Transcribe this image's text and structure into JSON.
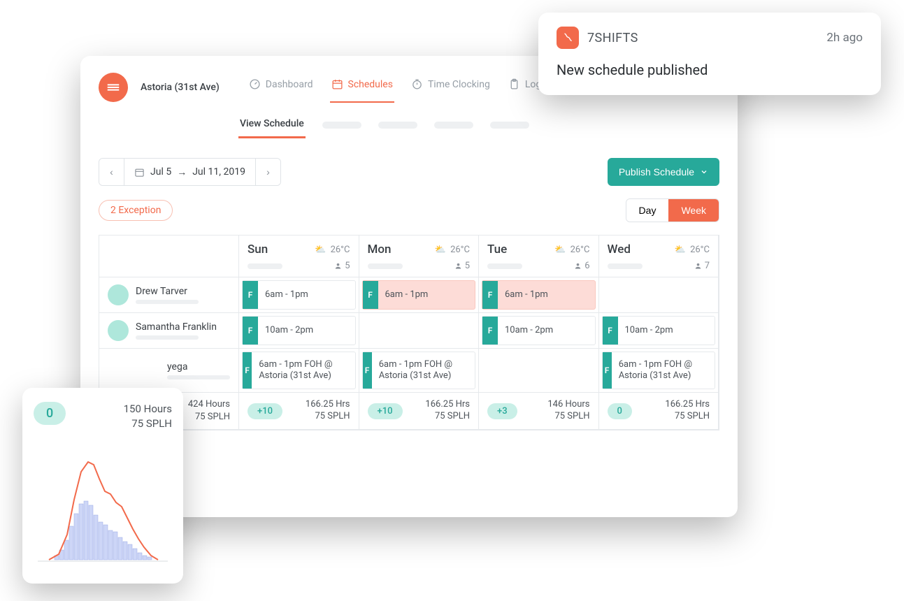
{
  "header": {
    "location": "Astoria (31st Ave)",
    "tabs": [
      {
        "label": "Dashboard"
      },
      {
        "label": "Schedules"
      },
      {
        "label": "Time Clocking"
      },
      {
        "label": "Log Book"
      }
    ],
    "activeTabIndex": 1
  },
  "subtabs": {
    "active": "View Schedule"
  },
  "toolbar": {
    "dateStart": "Jul 5",
    "dateArrow": "→",
    "dateEnd": "Jul 11, 2019",
    "publish": "Publish Schedule",
    "exception": "2 Exception",
    "viewDay": "Day",
    "viewWeek": "Week"
  },
  "days": [
    {
      "name": "Sun",
      "temp": "26°C",
      "count": "5"
    },
    {
      "name": "Mon",
      "temp": "26°C",
      "count": "5"
    },
    {
      "name": "Tue",
      "temp": "26°C",
      "count": "6"
    },
    {
      "name": "Wed",
      "temp": "26°C",
      "count": "7"
    }
  ],
  "employees": [
    {
      "name": "Drew Tarver"
    },
    {
      "name": "Samantha Franklin"
    },
    {
      "name": "yega"
    }
  ],
  "shifts": {
    "r0c0": "6am - 1pm",
    "r0c1": "6am - 1pm",
    "r0c2": "6am - 1pm",
    "r1c0": "10am - 2pm",
    "r1c2": "10am - 2pm",
    "r1c3": "10am - 2pm",
    "r2c0": "6am - 1pm FOH @ Astoria (31st Ave)",
    "r2c1": "6am - 1pm FOH @ Astoria (31st Ave)",
    "r2c3": "6am - 1pm FOH @ Astoria (31st Ave)",
    "tag": "F"
  },
  "summary": {
    "left": {
      "hours": "424 Hours",
      "splh": "75 SPLH"
    },
    "cols": [
      {
        "pill": "+10",
        "hours": "166.25 Hrs",
        "splh": "75 SPLH"
      },
      {
        "pill": "+10",
        "hours": "166.25 Hrs",
        "splh": "75 SPLH"
      },
      {
        "pill": "+3",
        "hours": "146 Hours",
        "splh": "75 SPLH"
      },
      {
        "pill": "0",
        "hours": "166.25 Hrs",
        "splh": "75 SPLH"
      }
    ]
  },
  "notification": {
    "app": "7SHIFTS",
    "time": "2h ago",
    "message": "New schedule published"
  },
  "chartCard": {
    "pill": "0",
    "hours": "150 Hours",
    "splh": "75 SPLH"
  },
  "colors": {
    "accent": "#f26a4b",
    "teal": "#27a99a",
    "tealLight": "#c9efe7"
  }
}
